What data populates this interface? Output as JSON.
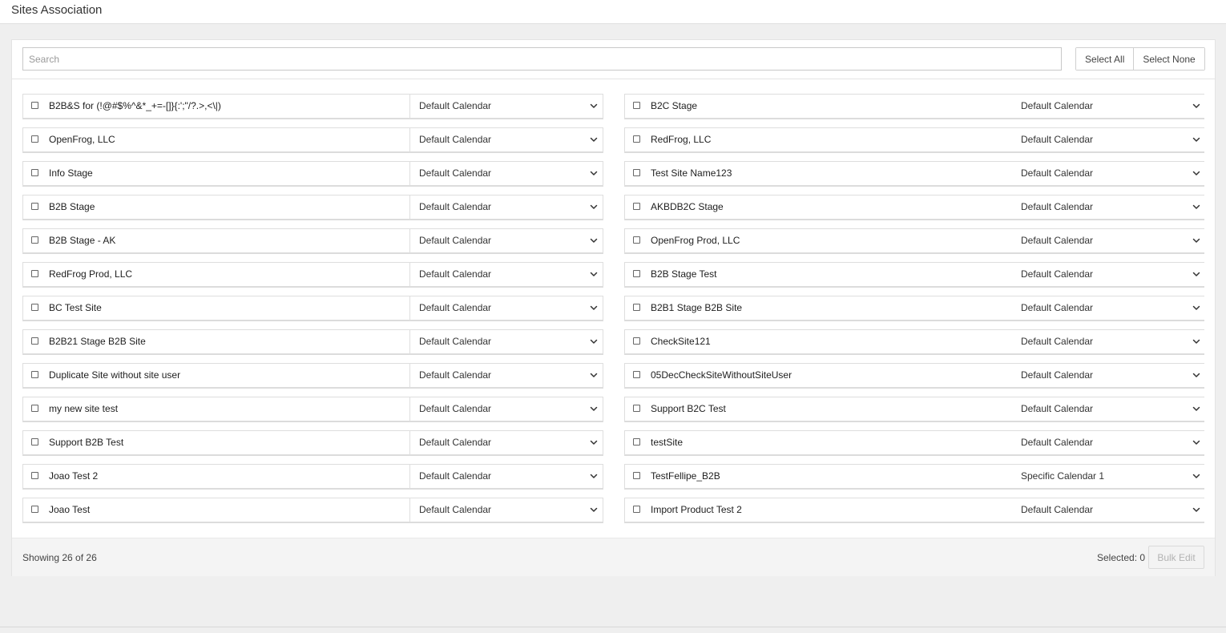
{
  "page": {
    "title": "Sites Association"
  },
  "search": {
    "placeholder": "Search",
    "value": ""
  },
  "toolbar": {
    "select_all_label": "Select All",
    "select_none_label": "Select None"
  },
  "sites": [
    {
      "name": "B2B&S for (!@#$%^&*_+=-[]}{:';\"/?.>,<\\|)",
      "calendar": "Default Calendar"
    },
    {
      "name": "B2C Stage",
      "calendar": "Default Calendar"
    },
    {
      "name": "OpenFrog, LLC",
      "calendar": "Default Calendar"
    },
    {
      "name": "RedFrog, LLC",
      "calendar": "Default Calendar"
    },
    {
      "name": "Info Stage",
      "calendar": "Default Calendar"
    },
    {
      "name": "Test Site Name123",
      "calendar": "Default Calendar"
    },
    {
      "name": "B2B Stage",
      "calendar": "Default Calendar"
    },
    {
      "name": "AKBDB2C Stage",
      "calendar": "Default Calendar"
    },
    {
      "name": "B2B Stage - AK",
      "calendar": "Default Calendar"
    },
    {
      "name": "OpenFrog Prod, LLC",
      "calendar": "Default Calendar"
    },
    {
      "name": "RedFrog Prod, LLC",
      "calendar": "Default Calendar"
    },
    {
      "name": "B2B Stage Test",
      "calendar": "Default Calendar"
    },
    {
      "name": "BC Test Site",
      "calendar": "Default Calendar"
    },
    {
      "name": "B2B1 Stage B2B Site",
      "calendar": "Default Calendar"
    },
    {
      "name": "B2B21 Stage B2B Site",
      "calendar": "Default Calendar"
    },
    {
      "name": "CheckSite121",
      "calendar": "Default Calendar"
    },
    {
      "name": "Duplicate Site without site user",
      "calendar": "Default Calendar"
    },
    {
      "name": "05DecCheckSiteWithoutSiteUser",
      "calendar": "Default Calendar"
    },
    {
      "name": "my new site test",
      "calendar": "Default Calendar"
    },
    {
      "name": "Support B2C Test",
      "calendar": "Default Calendar"
    },
    {
      "name": "Support B2B Test",
      "calendar": "Default Calendar"
    },
    {
      "name": "testSite",
      "calendar": "Default Calendar"
    },
    {
      "name": "Joao Test 2",
      "calendar": "Default Calendar"
    },
    {
      "name": "TestFellipe_B2B",
      "calendar": "Specific Calendar 1"
    },
    {
      "name": "Joao Test",
      "calendar": "Default Calendar"
    },
    {
      "name": "Import Product Test 2",
      "calendar": "Default Calendar"
    }
  ],
  "footer": {
    "showing_text": "Showing 26 of 26",
    "selected_text": "Selected: 0",
    "bulk_edit_label": "Bulk Edit"
  },
  "icons": {
    "checkbox": "checkbox-icon",
    "dropdown": "chevron-down-icon"
  },
  "colors": {
    "panel_bg": "#ffffff",
    "page_bg": "#efefef",
    "border": "#dedede"
  }
}
